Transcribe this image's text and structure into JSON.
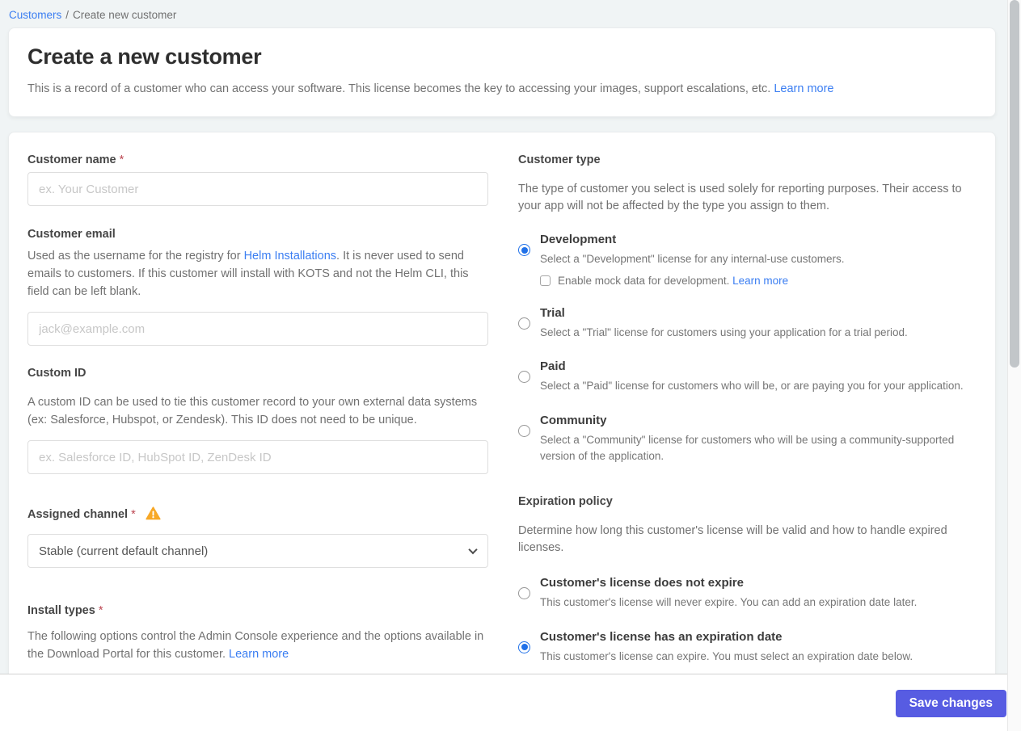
{
  "breadcrumb": {
    "link": "Customers",
    "separator": "/",
    "current": "Create new customer"
  },
  "header": {
    "title": "Create a new customer",
    "subtitle": "This is a record of a customer who can access your software. This license becomes the key to accessing your images, support escalations, etc.",
    "learn_more": "Learn more"
  },
  "form": {
    "customer_name": {
      "label": "Customer name",
      "required": "*",
      "placeholder": "ex. Your Customer",
      "value": ""
    },
    "customer_email": {
      "label": "Customer email",
      "desc_before": "Used as the username for the registry for ",
      "desc_link": "Helm Installations",
      "desc_after": ". It is never used to send emails to customers. If this customer will install with KOTS and not the Helm CLI, this field can be left blank.",
      "placeholder": "jack@example.com",
      "value": ""
    },
    "custom_id": {
      "label": "Custom ID",
      "desc": "A custom ID can be used to tie this customer record to your own external data systems (ex: Salesforce, Hubspot, or Zendesk). This ID does not need to be unique.",
      "placeholder": "ex. Salesforce ID, HubSpot ID, ZenDesk ID",
      "value": ""
    },
    "assigned_channel": {
      "label": "Assigned channel",
      "required": "*",
      "has_warning": true,
      "selected_option": "Stable (current default channel)"
    },
    "install_types": {
      "label": "Install types",
      "required": "*",
      "desc": "The following options control the Admin Console experience and the options available in the Download Portal for this customer.",
      "learn_more": "Learn more"
    },
    "customer_type": {
      "label": "Customer type",
      "desc": "The type of customer you select is used solely for reporting purposes. Their access to your app will not be affected by the type you assign to them.",
      "options": [
        {
          "title": "Development",
          "desc": "Select a \"Development\" license for any internal-use customers.",
          "selected": true
        },
        {
          "title": "Trial",
          "desc": "Select a \"Trial\" license for customers using your application for a trial period.",
          "selected": false
        },
        {
          "title": "Paid",
          "desc": "Select a \"Paid\" license for customers who will be, or are paying you for your application.",
          "selected": false
        },
        {
          "title": "Community",
          "desc": "Select a \"Community\" license for customers who will be using a community-supported version of the application.",
          "selected": false
        }
      ],
      "mock_checkbox": {
        "label": "Enable mock data for development.",
        "learn_more": "Learn more",
        "checked": false
      }
    },
    "expiration_policy": {
      "label": "Expiration policy",
      "desc": "Determine how long this customer's license will be valid and how to handle expired licenses.",
      "options": [
        {
          "title": "Customer's license does not expire",
          "desc": "This customer's license will never expire. You can add an expiration date later.",
          "selected": false
        },
        {
          "title": "Customer's license has an expiration date",
          "desc": "This customer's license can expire. You must select an expiration date below.",
          "selected": true
        }
      ]
    }
  },
  "footer": {
    "save_button": "Save changes"
  },
  "icons": {
    "warning": "warning-triangle-icon",
    "select_chevron": "chevron-down-icon"
  },
  "colors": {
    "link_blue": "#3b7ef2",
    "radio_selected_blue": "#2171e8",
    "save_button_indigo": "#575ce2",
    "required_red": "#bc4752",
    "warning_amber": "#f7a827",
    "page_background": "#f0f4f5"
  }
}
